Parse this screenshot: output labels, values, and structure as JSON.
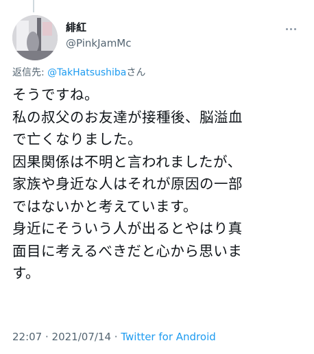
{
  "author": {
    "display_name": "緋紅",
    "handle": "@PinkJamMc"
  },
  "reply": {
    "prefix": "返信先: ",
    "mention": "@TakHatsushiba",
    "suffix": "さん"
  },
  "tweet": {
    "lines": [
      "そうですね。",
      "私の叔父のお友達が接種後、脳溢血",
      "で亡くなりました。",
      "因果関係は不明と言われましたが、",
      "家族や身近な人はそれが原因の一部",
      "ではないかと考えています。",
      "身近にそういう人が出るとやはり真",
      "面目に考えるべきだと心から思いま",
      "す。"
    ]
  },
  "meta": {
    "time": "22:07",
    "separator": " · ",
    "date": "2021/07/14",
    "source": "Twitter for Android"
  },
  "icons": {
    "more": "more-horizontal-icon"
  },
  "colors": {
    "link": "#1d9bf0",
    "secondary_text": "#536471",
    "primary_text": "#0f1419"
  }
}
